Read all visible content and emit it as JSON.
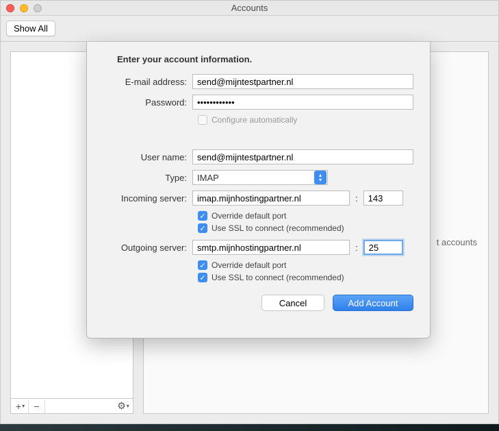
{
  "titlebar": {
    "title": "Accounts"
  },
  "toolbar": {
    "show_all": "Show All"
  },
  "right_panel": {
    "hint_trail": "t accounts"
  },
  "sheet": {
    "heading": "Enter your account information.",
    "labels": {
      "email": "E-mail address:",
      "password": "Password:",
      "configure_auto": "Configure automatically",
      "username": "User name:",
      "type": "Type:",
      "incoming": "Incoming server:",
      "outgoing": "Outgoing server:",
      "override_port": "Override default port",
      "use_ssl": "Use SSL to connect (recommended)"
    },
    "values": {
      "email": "send@mijntestpartner.nl",
      "password": "••••••••••••",
      "configure_auto_checked": false,
      "username": "send@mijntestpartner.nl",
      "type_selected": "IMAP",
      "incoming_server": "imap.mijnhostingpartner.nl",
      "incoming_port": "143",
      "incoming_override_checked": true,
      "incoming_ssl_checked": true,
      "outgoing_server": "smtp.mijnhostingpartner.nl",
      "outgoing_port": "25",
      "outgoing_override_checked": true,
      "outgoing_ssl_checked": true
    },
    "buttons": {
      "cancel": "Cancel",
      "add": "Add Account"
    }
  },
  "footer": {
    "add": "+",
    "remove": "−",
    "gear": "✱"
  }
}
